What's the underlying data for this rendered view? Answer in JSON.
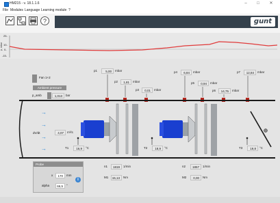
{
  "window": {
    "title": "HM215 - v. 18.1.1.6",
    "minimize": "–",
    "maximize": "□",
    "close": "✕"
  },
  "menu": [
    "File",
    "Modules",
    "Language",
    "Learning module",
    "?"
  ],
  "logo": "gunt",
  "chart": {
    "ylabel": "p, mbar",
    "ticks": [
      "25-",
      "10-",
      "0-",
      "-15-"
    ]
  },
  "fan_selector": {
    "label": "Fan 1+2"
  },
  "ambient": {
    "header": "Ambient pressure",
    "label": "p_amb",
    "value": "1,013",
    "unit": "bar"
  },
  "pressures": [
    {
      "label": "p1",
      "value": "5,00",
      "unit": "mbar"
    },
    {
      "label": "p2",
      "value": "1,81",
      "unit": "mbar"
    },
    {
      "label": "p3",
      "value": "0,01",
      "unit": "mbar"
    },
    {
      "label": "p4",
      "value": "6,84",
      "unit": "mbar"
    },
    {
      "label": "p5",
      "value": "0,94",
      "unit": "mbar"
    },
    {
      "label": "p6",
      "value": "14,75",
      "unit": "mbar"
    },
    {
      "label": "p7",
      "value": "12,84",
      "unit": "mbar"
    }
  ],
  "flow": {
    "label": "dV/dt",
    "value": "4,07",
    "unit": "m³/s"
  },
  "temps": [
    {
      "label": "T1",
      "value": "16,9",
      "unit": "°C"
    },
    {
      "label": "T2",
      "value": "18,9",
      "unit": "°C"
    },
    {
      "label": "T3",
      "value": "19,8",
      "unit": "°C"
    }
  ],
  "speeds": [
    {
      "label": "n1",
      "value": "1819",
      "unit": "1/min"
    },
    {
      "label": "n2",
      "value": "1857",
      "unit": "1/min"
    }
  ],
  "torques": [
    {
      "label": "M1",
      "value": "15,13",
      "unit": "Nm"
    },
    {
      "label": "M2",
      "value": "0,00",
      "unit": "Nm"
    }
  ],
  "probe": {
    "header": "Probe",
    "x_label": "x",
    "x_value": "170",
    "x_unit": "mm",
    "alpha_label": "alpha",
    "alpha_value": "66,5",
    "alpha_unit": "°",
    "info": "i"
  },
  "colors": {
    "line": "#e03a3a",
    "motor": "#1a3fd0",
    "accent": "#2c86d6",
    "stripe": "#34414c"
  }
}
